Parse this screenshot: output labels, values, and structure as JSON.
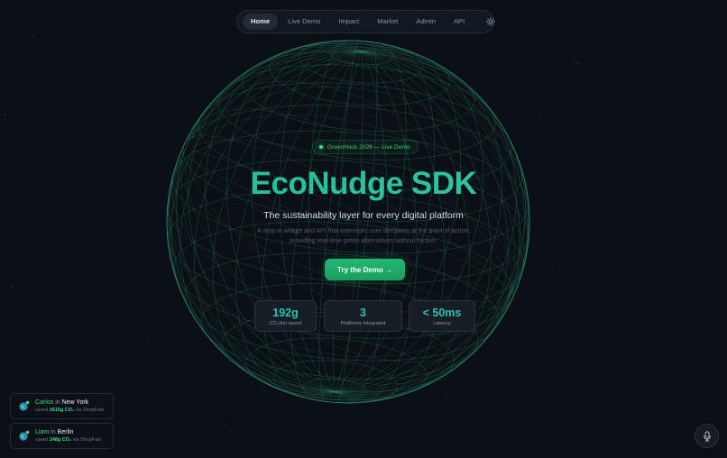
{
  "nav": {
    "items": [
      {
        "label": "Home",
        "active": true
      },
      {
        "label": "Live Demo",
        "active": false
      },
      {
        "label": "Impact",
        "active": false
      },
      {
        "label": "Market",
        "active": false
      },
      {
        "label": "Admin",
        "active": false
      },
      {
        "label": "API",
        "active": false
      }
    ],
    "theme_icon": "sun-icon"
  },
  "hero": {
    "badge": "GreenHack 2026 — Live Demo",
    "title": "EcoNudge SDK",
    "subtitle": "The sustainability layer for every digital platform",
    "description": "A drop-in widget and API that intercepts user decisions at the point of action, providing real-time green alternatives without friction.",
    "cta_label": "Try the Demo →"
  },
  "stats": [
    {
      "value": "192g",
      "label": "CO₂/km saved"
    },
    {
      "value": "3",
      "label": "Platforms integrated"
    },
    {
      "value": "< 50ms",
      "label": "Latency"
    }
  ],
  "toasts": [
    {
      "name": "Carlos",
      "in": "in",
      "city": "New York",
      "saved_prefix": "saved",
      "amount": "1615g CO₂",
      "via": "via ShopFast"
    },
    {
      "name": "Liam",
      "in": "in",
      "city": "Berlin",
      "saved_prefix": "saved",
      "amount": "248g CO₂",
      "via": "via ShopFast"
    }
  ],
  "mic_icon": "microphone-icon",
  "colors": {
    "background": "#0b0f16",
    "accent_green": "#22c55e",
    "title_teal": "#2fbf9a",
    "stat_value": "#2cc2b0"
  }
}
